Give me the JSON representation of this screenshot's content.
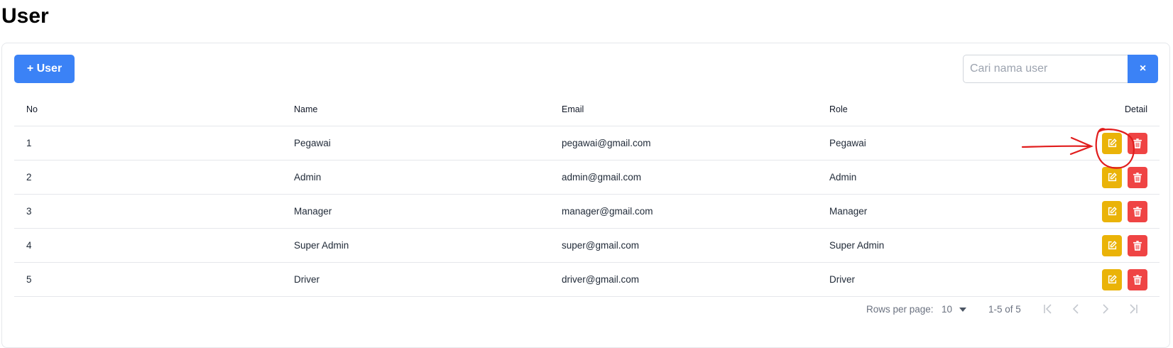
{
  "page": {
    "title": "User"
  },
  "toolbar": {
    "add_label": "+ User"
  },
  "search": {
    "placeholder": "Cari nama user",
    "value": "",
    "clear_label": "×"
  },
  "table": {
    "headers": {
      "no": "No",
      "name": "Name",
      "email": "Email",
      "role": "Role",
      "detail": "Detail"
    },
    "rows": [
      {
        "no": "1",
        "name": "Pegawai",
        "email": "pegawai@gmail.com",
        "role": "Pegawai"
      },
      {
        "no": "2",
        "name": "Admin",
        "email": "admin@gmail.com",
        "role": "Admin"
      },
      {
        "no": "3",
        "name": "Manager",
        "email": "manager@gmail.com",
        "role": "Manager"
      },
      {
        "no": "4",
        "name": "Super Admin",
        "email": "super@gmail.com",
        "role": "Super Admin"
      },
      {
        "no": "5",
        "name": "Driver",
        "email": "driver@gmail.com",
        "role": "Driver"
      }
    ]
  },
  "pagination": {
    "rows_per_page_label": "Rows per page:",
    "rows_per_page_value": "10",
    "range": "1-5 of 5"
  },
  "icons": {
    "edit": "edit-icon",
    "delete": "trash-icon",
    "dropdown": "caret-down-icon",
    "first": "first-page-icon",
    "prev": "chevron-left-icon",
    "next": "chevron-right-icon",
    "last": "last-page-icon"
  },
  "colors": {
    "primary": "#3b82f6",
    "edit": "#eab308",
    "delete": "#ef4444",
    "annotation": "#e11d1d"
  }
}
